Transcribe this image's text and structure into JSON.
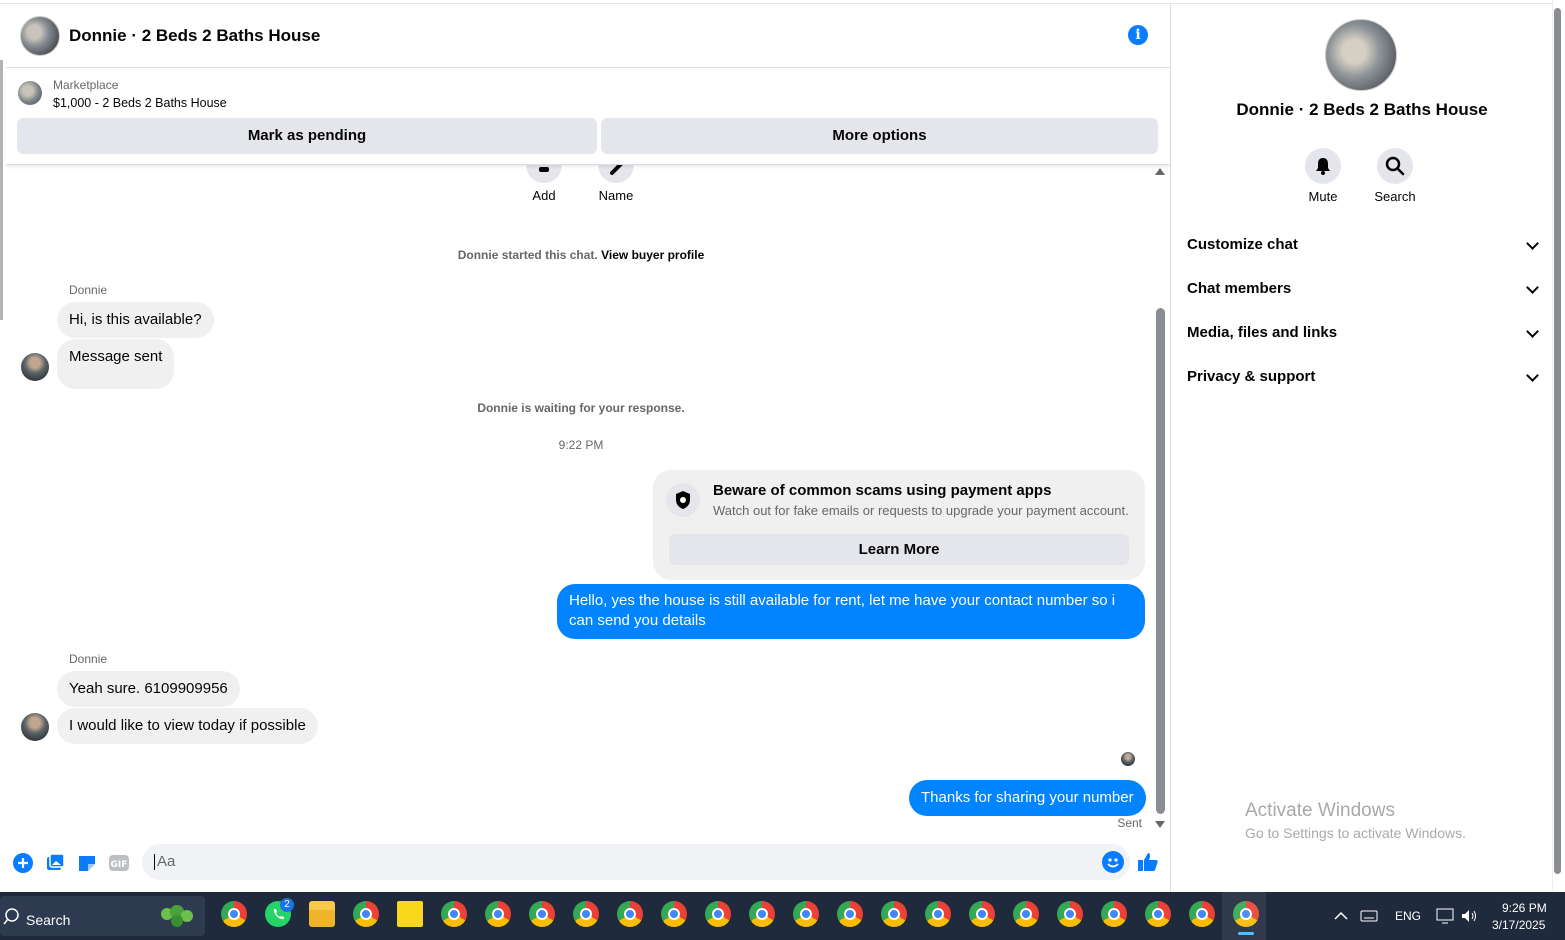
{
  "chat": {
    "title": "Donnie · 2 Beds 2 Baths House",
    "marketplace_label": "Marketplace",
    "listing": "$1,000 - 2 Beds 2 Baths House",
    "mark_pending": "Mark as pending",
    "more_options": "More options",
    "add_label": "Add",
    "name_label": "Name",
    "started_text": "Donnie started this chat.",
    "view_profile": "View buyer profile",
    "waiting_text": "Donnie is waiting for your response.",
    "timestamp": "9:22 PM",
    "messages": [
      {
        "sender": "Donnie",
        "text": "Hi, is this available?"
      },
      {
        "text": "Message sent"
      },
      {
        "text": "Hello, yes the house is still available for rent, let me have your contact number so i can send you  details"
      },
      {
        "sender": "Donnie",
        "text": "Yeah sure. 6109909956"
      },
      {
        "text": "I would like to view today if possible"
      },
      {
        "text": "Thanks for sharing your number"
      }
    ],
    "warning": {
      "title": "Beware of common scams using payment apps",
      "subtitle": "Watch out for fake emails or requests to upgrade your payment account.",
      "button": "Learn More"
    },
    "sent_status": "Sent",
    "composer_placeholder": "Aa",
    "accent_color": "#0084ff"
  },
  "panel": {
    "title": "Donnie · 2 Beds 2 Baths House",
    "mute": "Mute",
    "search": "Search",
    "sections": [
      "Customize chat",
      "Chat members",
      "Media, files and links",
      "Privacy & support"
    ]
  },
  "watermark": {
    "line1": "Activate Windows",
    "line2": "Go to Settings to activate Windows."
  },
  "taskbar": {
    "search": "Search",
    "whatsapp_badge": "2",
    "lang": "ENG",
    "time": "9:26 PM",
    "date": "3/17/2025"
  }
}
